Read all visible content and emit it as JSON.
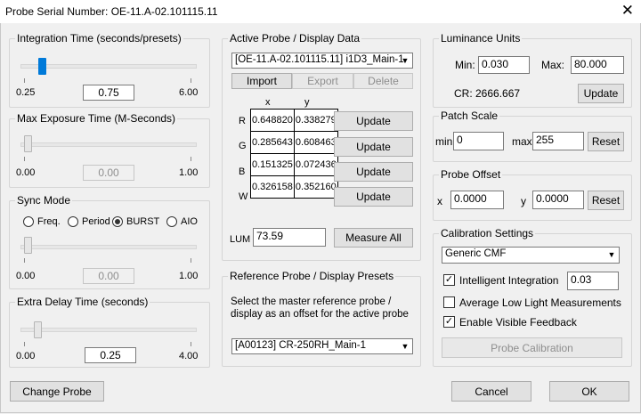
{
  "window": {
    "title": "Probe Serial Number: OE-11.A-02.101115.11",
    "close_glyph": "✕"
  },
  "integration": {
    "legend": "Integration Time (seconds/presets)",
    "min": "0.25",
    "max": "6.00",
    "value": "0.75",
    "slider_fraction": 0.089
  },
  "exposure": {
    "legend": "Max Exposure Time (M-Seconds)",
    "min": "0.00",
    "max": "1.00",
    "value": "0.00",
    "slider_fraction": 0.0
  },
  "sync": {
    "legend": "Sync Mode",
    "options": [
      "Freq.",
      "Period",
      "BURST",
      "AIO"
    ],
    "selected": "BURST",
    "min": "0.00",
    "max": "1.00",
    "value": "0.00",
    "slider_fraction": 0.0
  },
  "delay": {
    "legend": "Extra Delay Time (seconds)",
    "min": "0.00",
    "max": "4.00",
    "value": "0.25",
    "slider_fraction": 0.0625
  },
  "active_probe": {
    "legend": "Active Probe / Display Data",
    "selected": "[OE-11.A-02.101115.11] i1D3_Main-1",
    "import_label": "Import",
    "export_label": "Export",
    "delete_label": "Delete",
    "col_x": "x",
    "col_y": "y",
    "rows": [
      {
        "label": "R",
        "x": "0.648820",
        "y": "0.338279",
        "button": "Update"
      },
      {
        "label": "G",
        "x": "0.285643",
        "y": "0.608463",
        "button": "Update"
      },
      {
        "label": "B",
        "x": "0.151325",
        "y": "0.072436",
        "button": "Update"
      },
      {
        "label": "W",
        "x": "0.326158",
        "y": "0.352160",
        "button": "Update"
      }
    ],
    "lum_label": "LUM",
    "lum_value": "73.59",
    "measure_all_label": "Measure All"
  },
  "reference": {
    "legend": "Reference Probe / Display Presets",
    "description_line1": "Select the master reference probe /",
    "description_line2": "display as an offset for the active probe",
    "selected": "[A00123] CR-250RH_Main-1"
  },
  "luminance": {
    "legend": "Luminance Units",
    "min_label": "Min:",
    "min_value": "0.030",
    "max_label": "Max:",
    "max_value": "80.000",
    "cr_text": "CR: 2666.667",
    "update_label": "Update"
  },
  "patch": {
    "legend": "Patch Scale",
    "min_label": "min",
    "min_value": "0",
    "max_label": "max",
    "max_value": "255",
    "reset_label": "Reset"
  },
  "offset": {
    "legend": "Probe Offset",
    "x_label": "x",
    "x_value": "0.0000",
    "y_label": "y",
    "y_value": "0.0000",
    "reset_label": "Reset"
  },
  "calibration": {
    "legend": "Calibration Settings",
    "cmf_selected": "Generic CMF",
    "intelligent_label": "Intelligent Integration",
    "intelligent_checked": true,
    "intelligent_value": "0.03",
    "average_label": "Average Low Light Measurements",
    "average_checked": false,
    "feedback_label": "Enable Visible Feedback",
    "feedback_checked": true,
    "probe_cal_label": "Probe Calibration"
  },
  "footer": {
    "change_probe_label": "Change Probe",
    "cancel_label": "Cancel",
    "ok_label": "OK"
  },
  "glyphs": {
    "checkmark": "✓",
    "dropdown_arrow": "▼"
  }
}
